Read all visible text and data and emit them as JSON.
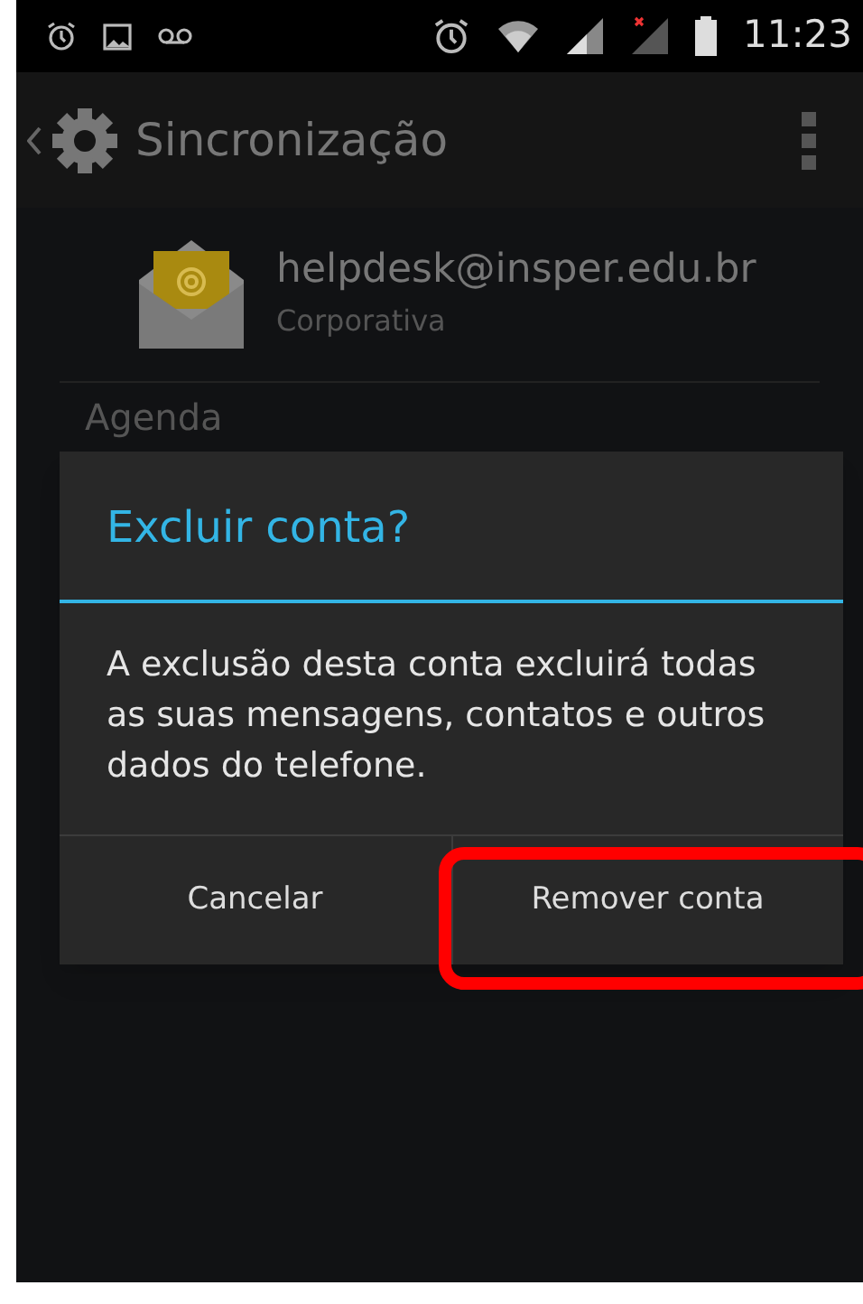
{
  "status_bar": {
    "time": "11:23"
  },
  "action_bar": {
    "title": "Sincronização"
  },
  "account": {
    "email": "helpdesk@insper.edu.br",
    "type": "Corporativa"
  },
  "list": {
    "items": [
      "Agenda"
    ]
  },
  "dialog": {
    "title": "Excluir conta?",
    "message": "A exclusão desta conta excluirá todas as suas mensagens, contatos e outros dados do telefone.",
    "buttons": [
      {
        "label": "Cancelar",
        "highlighted": false
      },
      {
        "label": "Remover conta",
        "highlighted": true
      }
    ]
  }
}
